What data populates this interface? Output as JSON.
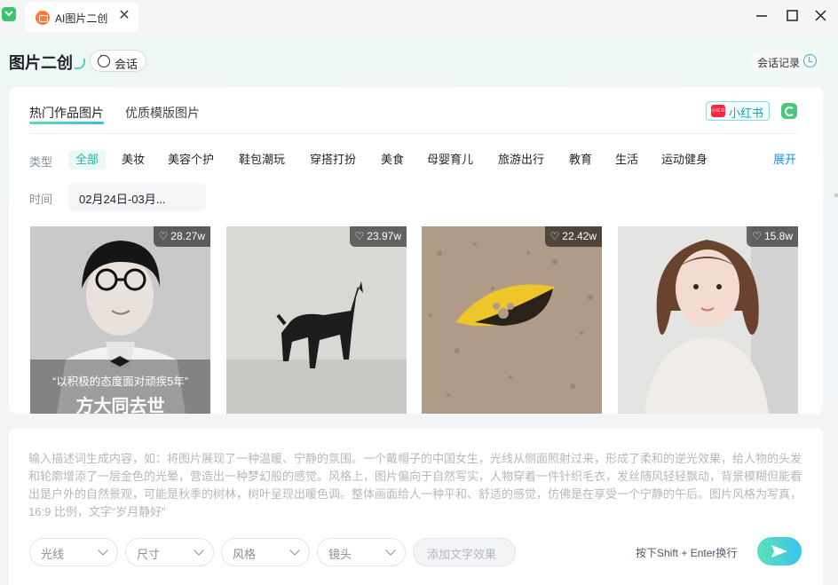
{
  "window": {
    "tab_title": "AI图片二创",
    "tab_close": "✕"
  },
  "header": {
    "title": "图片二创",
    "chat_label": "会话",
    "history_label": "会话记录"
  },
  "subtabs": [
    "热门作品图片",
    "优质模版图片"
  ],
  "source_badge": {
    "logo_text": "小红书",
    "label": "小红书"
  },
  "filters": {
    "type_label": "类型",
    "categories": [
      "全部",
      "美妆",
      "美容个护",
      "鞋包潮玩",
      "穿搭打扮",
      "美食",
      "母婴育儿",
      "旅游出行",
      "教育",
      "生活",
      "运动健身"
    ],
    "active_category": "全部",
    "expand_label": "展开",
    "time_label": "时间",
    "time_value": "02月24日-03月..."
  },
  "gallery": [
    {
      "likes": "28.27w",
      "caption_top": "“以积极的态度面对顽疾5年”",
      "caption_bottom": "方大同去世"
    },
    {
      "likes": "23.97w"
    },
    {
      "likes": "22.42w"
    },
    {
      "likes": "15.8w"
    }
  ],
  "prompt": {
    "placeholder": "输入描述词生成内容，如：将图片展现了一种温暖、宁静的氛围。一个戴帽子的中国女生，光线从侧面照射过来，形成了柔和的逆光效果，给人物的头发和轮廓增添了一层金色的光晕，营造出一种梦幻般的感觉。风格上，图片偏向于自然写实，人物穿着一件针织毛衣，发丝随风轻轻飘动，背景模糊但能看出是户外的自然景观，可能是秋季的树林，树叶呈现出暖色调。整体画面给人一种平和、舒适的感觉，仿佛是在享受一个宁静的午后。图片风格为写真，16:9 比例，文字“岁月静好”",
    "options": [
      "光线",
      "尺寸",
      "风格",
      "镜头"
    ],
    "text_effect_label": "添加文字效果",
    "hint": "按下Shift + Enter换行"
  },
  "colors": {
    "accent": "#1fb5a3",
    "brand_gradient_start": "#5ce2b7",
    "brand_gradient_end": "#38c3f0",
    "link": "#1f8ce0"
  }
}
